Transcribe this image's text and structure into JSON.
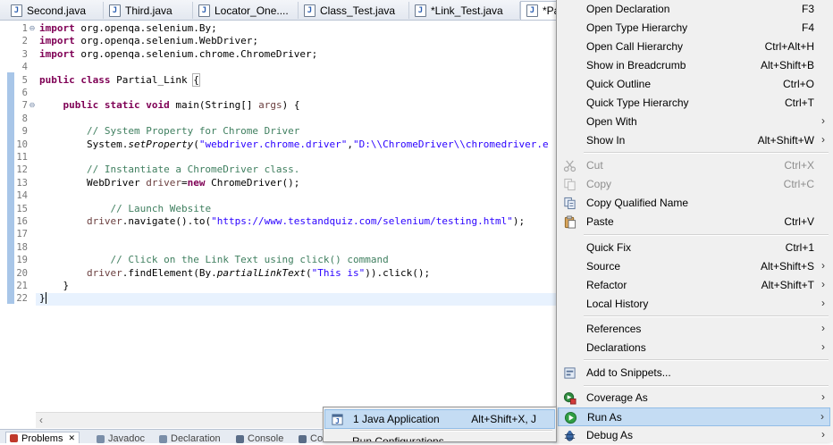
{
  "editor_tabs": [
    {
      "label": "Second.java",
      "active": false
    },
    {
      "label": "Third.java",
      "active": false
    },
    {
      "label": "Locator_One....",
      "active": false
    },
    {
      "label": "Class_Test.java",
      "active": false
    },
    {
      "label": "*Link_Test.java",
      "active": false
    },
    {
      "label": "*Pa",
      "active": true
    }
  ],
  "editor": {
    "line_numbers": [
      "1",
      "2",
      "3",
      "4",
      "5",
      "6",
      "7",
      "8",
      "9",
      "10",
      "11",
      "12",
      "13",
      "14",
      "15",
      "16",
      "17",
      "18",
      "19",
      "20",
      "21",
      "22"
    ],
    "code": {
      "l1": {
        "kw": "import",
        "rest": " org.openqa.selenium.By;"
      },
      "l2": {
        "kw": "import",
        "rest": " org.openqa.selenium.WebDriver;"
      },
      "l3": {
        "kw": "import",
        "rest": " org.openqa.selenium.chrome.ChromeDriver;"
      },
      "l5": {
        "kw1": "public",
        "kw2": "class",
        "name": " Partial_Link ",
        "brace": "{"
      },
      "l7": {
        "kw1": "public",
        "kw2": "static",
        "kw3": "void",
        "rest1": " main(String[] ",
        "var": "args",
        "rest2": ") {"
      },
      "l9": {
        "comment": "// System Property for Chrome Driver"
      },
      "l10": {
        "pre": "System.",
        "method": "setProperty",
        "p1": "(",
        "s1": "\"webdriver.chrome.driver\"",
        "p2": ",",
        "s2": "\"D:\\\\ChromeDriver\\\\chromedriver.e"
      },
      "l12": {
        "comment": "// Instantiate a ChromeDriver class."
      },
      "l13": {
        "pre": "WebDriver ",
        "var": "driver",
        "eq": "=",
        "kw": "new",
        "rest": " ChromeDriver();"
      },
      "l15": {
        "comment": "// Launch Website"
      },
      "l16": {
        "var": "driver",
        "pre": ".navigate().to(",
        "str": "\"https://www.testandquiz.com/selenium/testing.html\"",
        "post": ");"
      },
      "l19": {
        "comment": "// Click on the Link Text using click() command"
      },
      "l20": {
        "var": "driver",
        "pre": ".findElement(By.",
        "method": "partialLinkText",
        "p1": "(",
        "str": "\"This is\"",
        "post": ")).click();"
      },
      "l21": {
        "text": "}"
      },
      "l22": {
        "text": "}"
      }
    }
  },
  "bottom_views": [
    "Problems",
    "Javadoc",
    "Declaration",
    "Console",
    "Co"
  ],
  "context_menu": [
    {
      "label": "Open Declaration",
      "shortcut": "F3"
    },
    {
      "label": "Open Type Hierarchy",
      "shortcut": "F4"
    },
    {
      "label": "Open Call Hierarchy",
      "shortcut": "Ctrl+Alt+H"
    },
    {
      "label": "Show in Breadcrumb",
      "shortcut": "Alt+Shift+B"
    },
    {
      "label": "Quick Outline",
      "shortcut": "Ctrl+O"
    },
    {
      "label": "Quick Type Hierarchy",
      "shortcut": "Ctrl+T"
    },
    {
      "label": "Open With",
      "shortcut": ""
    },
    {
      "label": "Show In",
      "shortcut": "Alt+Shift+W"
    },
    {
      "label": "Cut",
      "shortcut": "Ctrl+X"
    },
    {
      "label": "Copy",
      "shortcut": "Ctrl+C"
    },
    {
      "label": "Copy Qualified Name",
      "shortcut": ""
    },
    {
      "label": "Paste",
      "shortcut": "Ctrl+V"
    },
    {
      "label": "Quick Fix",
      "shortcut": "Ctrl+1"
    },
    {
      "label": "Source",
      "shortcut": "Alt+Shift+S"
    },
    {
      "label": "Refactor",
      "shortcut": "Alt+Shift+T"
    },
    {
      "label": "Local History",
      "shortcut": ""
    },
    {
      "label": "References",
      "shortcut": ""
    },
    {
      "label": "Declarations",
      "shortcut": ""
    },
    {
      "label": "Add to Snippets...",
      "shortcut": ""
    },
    {
      "label": "Coverage As",
      "shortcut": ""
    },
    {
      "label": "Run As",
      "shortcut": ""
    },
    {
      "label": "Debug As",
      "shortcut": ""
    }
  ],
  "run_as_submenu": [
    {
      "label": "1 Java Application",
      "shortcut": "Alt+Shift+X, J"
    },
    {
      "label": "Run Configurations...",
      "shortcut": ""
    }
  ],
  "colors": {
    "menu_highlight": "#c4dcf3",
    "keyword": "#7f0055",
    "comment": "#3f7f5f",
    "string": "#2a00ff",
    "variable": "#6a3e3e"
  },
  "icons": {
    "tab": "java-file-icon",
    "cut": "scissors-icon",
    "copy": "copy-icon",
    "copy_qualified": "copy-qualified-name-icon",
    "paste": "clipboard-icon",
    "snippets": "snippets-icon",
    "coverage": "coverage-icon",
    "run": "run-icon",
    "debug": "bug-icon",
    "submenu": "chevron-right-icon"
  }
}
